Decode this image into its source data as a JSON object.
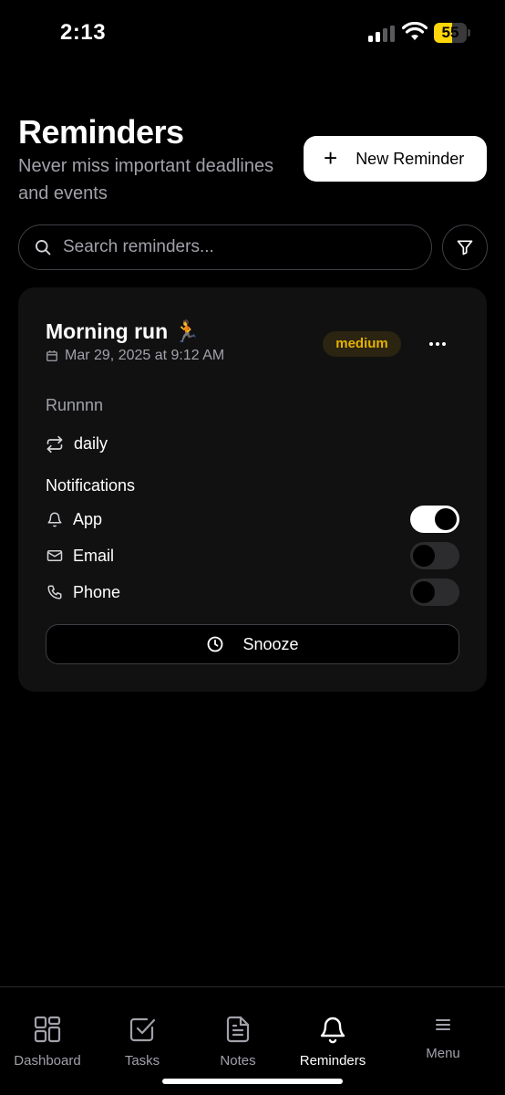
{
  "status_bar": {
    "time": "2:13",
    "battery": "55",
    "battery_level": 0.55
  },
  "header": {
    "title": "Reminders",
    "subtitle": "Never miss important deadlines and events",
    "new_button_label": "New Reminder"
  },
  "search": {
    "placeholder": "Search reminders..."
  },
  "reminder": {
    "title": "Morning run 🏃",
    "date": "Mar 29, 2025 at 9:12 AM",
    "priority": "medium",
    "description": "Runnnn",
    "repeat": "daily",
    "notifications_title": "Notifications",
    "notifications": [
      {
        "label": "App",
        "enabled": true,
        "icon": "bell-icon"
      },
      {
        "label": "Email",
        "enabled": false,
        "icon": "mail-icon"
      },
      {
        "label": "Phone",
        "enabled": false,
        "icon": "phone-icon"
      }
    ],
    "snooze_label": "Snooze"
  },
  "tabs": [
    {
      "label": "Dashboard",
      "icon": "dashboard-icon",
      "active": false
    },
    {
      "label": "Tasks",
      "icon": "tasks-icon",
      "active": false
    },
    {
      "label": "Notes",
      "icon": "notes-icon",
      "active": false
    },
    {
      "label": "Reminders",
      "icon": "bell-icon",
      "active": true
    },
    {
      "label": "Menu",
      "icon": "menu-icon",
      "active": false
    }
  ],
  "colors": {
    "background": "#000000",
    "card": "#111112",
    "priority_medium": "#e5b100",
    "muted_text": "#a1a1aa",
    "battery": "#ffd60a"
  }
}
